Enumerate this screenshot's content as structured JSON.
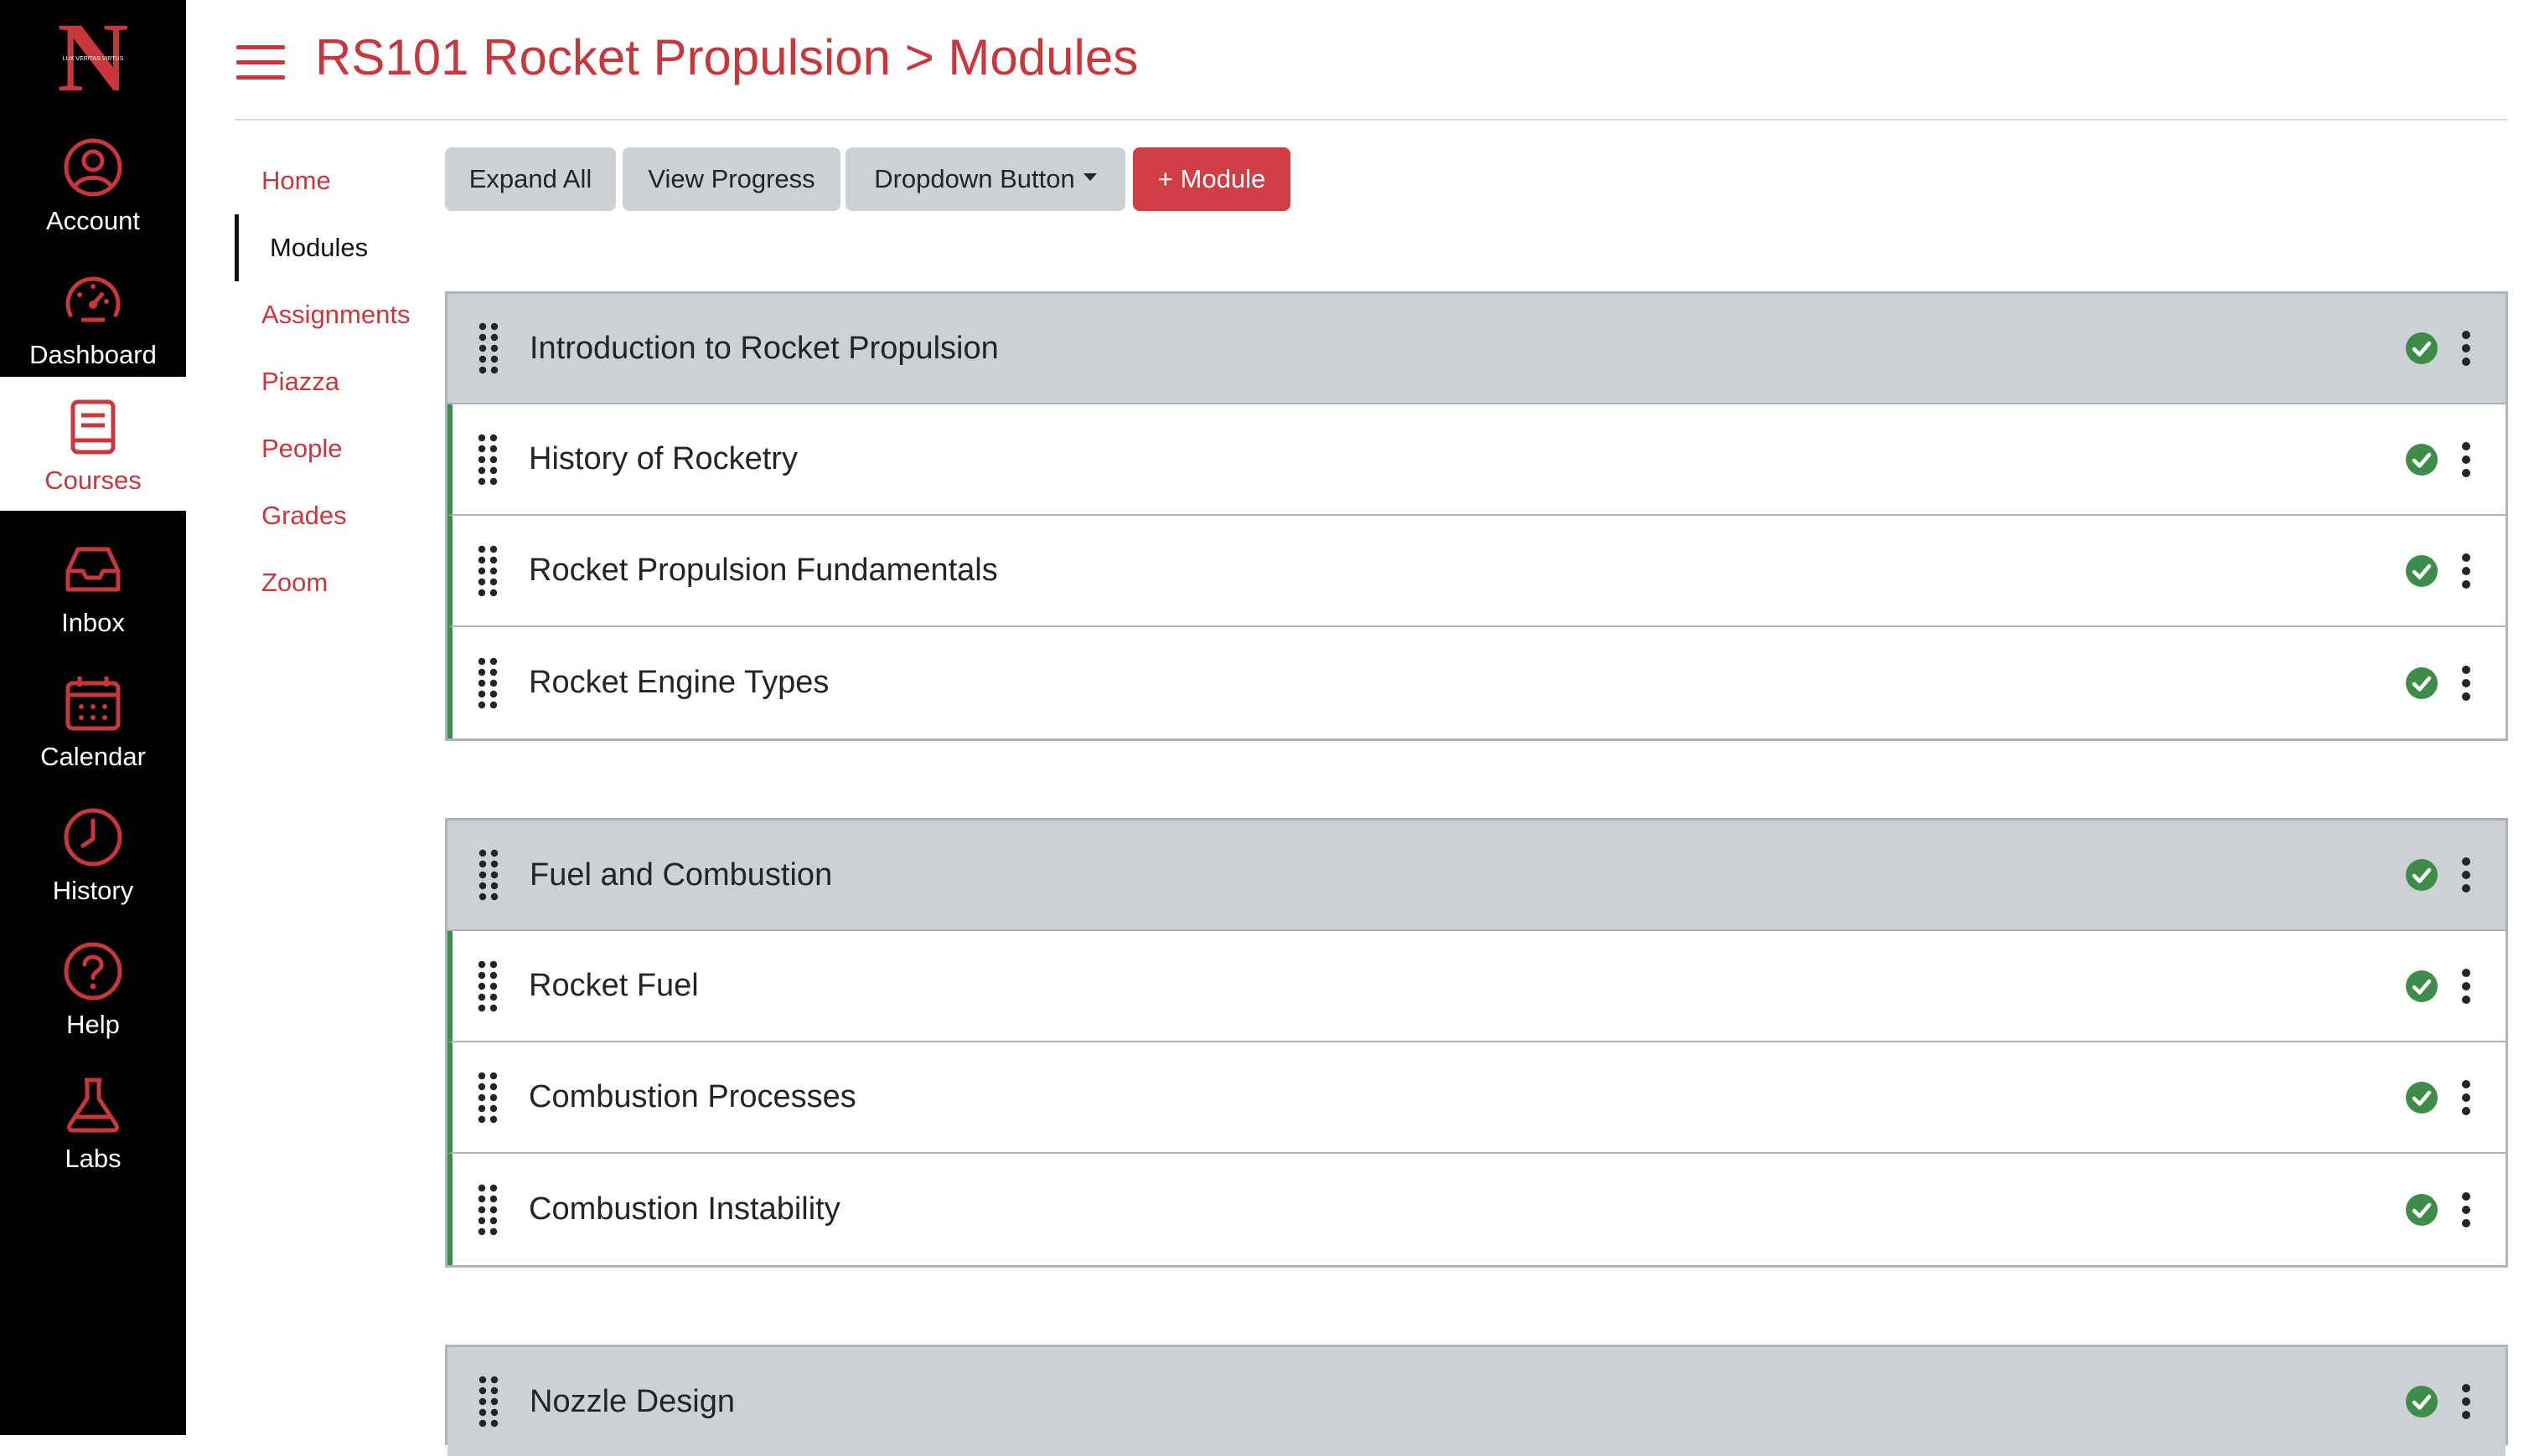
{
  "global_nav": {
    "logo_letter": "N",
    "logo_motto": "LUX VERITAS VIRTUS",
    "items": [
      {
        "label": "Account",
        "icon": "account-circle-icon"
      },
      {
        "label": "Dashboard",
        "icon": "speedometer-icon"
      },
      {
        "label": "Courses",
        "icon": "book-icon",
        "active": true
      },
      {
        "label": "Inbox",
        "icon": "inbox-tray-icon"
      },
      {
        "label": "Calendar",
        "icon": "calendar-icon"
      },
      {
        "label": "History",
        "icon": "clock-icon"
      },
      {
        "label": "Help",
        "icon": "question-circle-icon"
      },
      {
        "label": "Labs",
        "icon": "flask-icon"
      }
    ]
  },
  "header": {
    "title": "RS101 Rocket Propulsion > Modules"
  },
  "course_nav": {
    "items": [
      {
        "label": "Home"
      },
      {
        "label": "Modules",
        "active": true
      },
      {
        "label": "Assignments"
      },
      {
        "label": "Piazza"
      },
      {
        "label": "People"
      },
      {
        "label": "Grades"
      },
      {
        "label": "Zoom"
      }
    ]
  },
  "toolbar": {
    "expand_all": "Expand All",
    "view_progress": "View Progress",
    "dropdown": "Dropdown Button",
    "add_module": "+ Module"
  },
  "modules": [
    {
      "title": "Introduction to Rocket Propulsion",
      "items": [
        "History of Rocketry",
        "Rocket Propulsion Fundamentals",
        "Rocket Engine Types"
      ]
    },
    {
      "title": "Fuel and Combustion",
      "items": [
        "Rocket Fuel",
        "Combustion Processes",
        "Combustion Instability"
      ]
    },
    {
      "title": "Nozzle Design",
      "items": []
    }
  ],
  "colors": {
    "brand_red": "#c8373c",
    "header_gray": "#ccd1d5",
    "complete_green": "#3d8c47"
  }
}
